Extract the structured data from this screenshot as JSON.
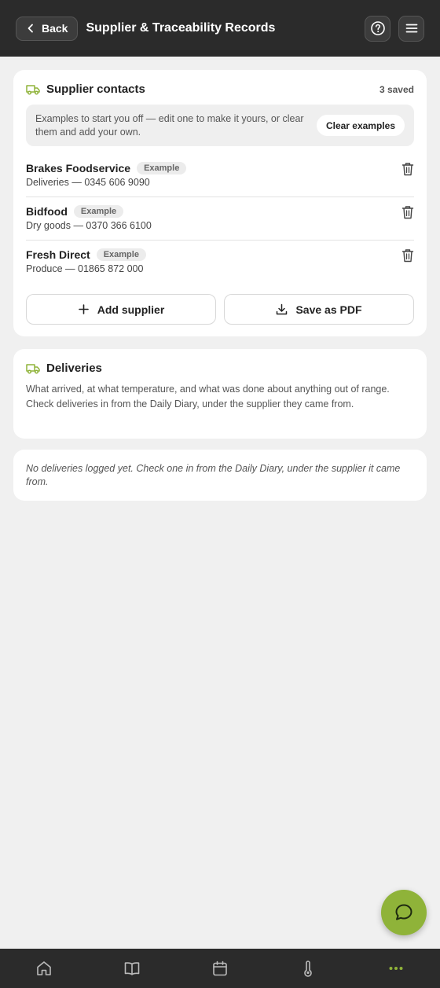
{
  "header": {
    "back_label": "Back",
    "title": "Supplier & Traceability Records"
  },
  "suppliers_card": {
    "title": "Supplier contacts",
    "saved_count": "3 saved",
    "notice_text": "Examples to start you off — edit one to make it yours, or clear them and add your own.",
    "clear_label": "Clear examples",
    "items": [
      {
        "name": "Brakes Foodservice",
        "badge": "Example",
        "detail": "Deliveries — 0345 606 9090"
      },
      {
        "name": "Bidfood",
        "badge": "Example",
        "detail": "Dry goods — 0370 366 6100"
      },
      {
        "name": "Fresh Direct",
        "badge": "Example",
        "detail": "Produce — 01865 872 000"
      }
    ],
    "add_label": "Add supplier",
    "pdf_label": "Save as PDF"
  },
  "deliveries_card": {
    "title": "Deliveries",
    "description": "What arrived, at what temperature, and what was done about anything out of range. Check deliveries in from the Daily Diary, under the supplier they came from."
  },
  "empty_card": {
    "text": "No deliveries logged yet. Check one in from the Daily Diary, under the supplier it came from."
  },
  "colors": {
    "accent": "#8fb339",
    "header_bg": "#2b2b2b",
    "page_bg": "#f0f0f0"
  },
  "icons": [
    "chevron-left-icon",
    "help-icon",
    "menu-icon",
    "truck-icon",
    "trash-icon",
    "plus-icon",
    "download-icon",
    "chat-icon",
    "home-icon",
    "book-icon",
    "calendar-icon",
    "thermometer-icon",
    "more-icon"
  ]
}
